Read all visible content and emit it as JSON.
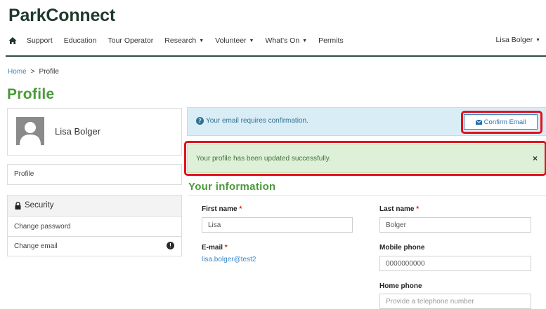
{
  "header": {
    "brand": "ParkConnect",
    "nav": [
      {
        "label": "Support",
        "dropdown": false
      },
      {
        "label": "Education",
        "dropdown": false
      },
      {
        "label": "Tour Operator",
        "dropdown": false
      },
      {
        "label": "Research",
        "dropdown": true
      },
      {
        "label": "Volunteer",
        "dropdown": true
      },
      {
        "label": "What's On",
        "dropdown": true
      },
      {
        "label": "Permits",
        "dropdown": false
      }
    ],
    "user_menu": "Lisa Bolger",
    "caret": "▼"
  },
  "breadcrumb": {
    "home": "Home",
    "separator": ">",
    "current": "Profile"
  },
  "page_title": "Profile",
  "sidebar": {
    "profile_name": "Lisa Bolger",
    "profile_link": "Profile",
    "security": {
      "title": "Security",
      "items": [
        {
          "label": "Change password"
        },
        {
          "label": "Change email",
          "badge": "!"
        }
      ]
    }
  },
  "alerts": {
    "info": {
      "text": "Your email requires confirmation.",
      "icon": "?",
      "button": "Confirm Email"
    },
    "success": {
      "text": "Your profile has been updated successfully.",
      "close": "×"
    }
  },
  "form": {
    "section_title": "Your information",
    "required_mark": "*",
    "first_name": {
      "label": "First name",
      "value": "Lisa"
    },
    "last_name": {
      "label": "Last name",
      "value": "Bolger"
    },
    "email": {
      "label": "E-mail",
      "value": "lisa.bolger@test2"
    },
    "mobile_phone": {
      "label": "Mobile phone",
      "value": "0000000000"
    },
    "home_phone": {
      "label": "Home phone",
      "placeholder": "Provide a telephone number"
    }
  },
  "colors": {
    "brand": "#1f3a2c",
    "title_green": "#4a9a3a",
    "link_blue": "#3a87c8",
    "highlight_red": "#e0121b",
    "info_bg": "#d9edf7",
    "success_bg": "#dff0d8"
  }
}
